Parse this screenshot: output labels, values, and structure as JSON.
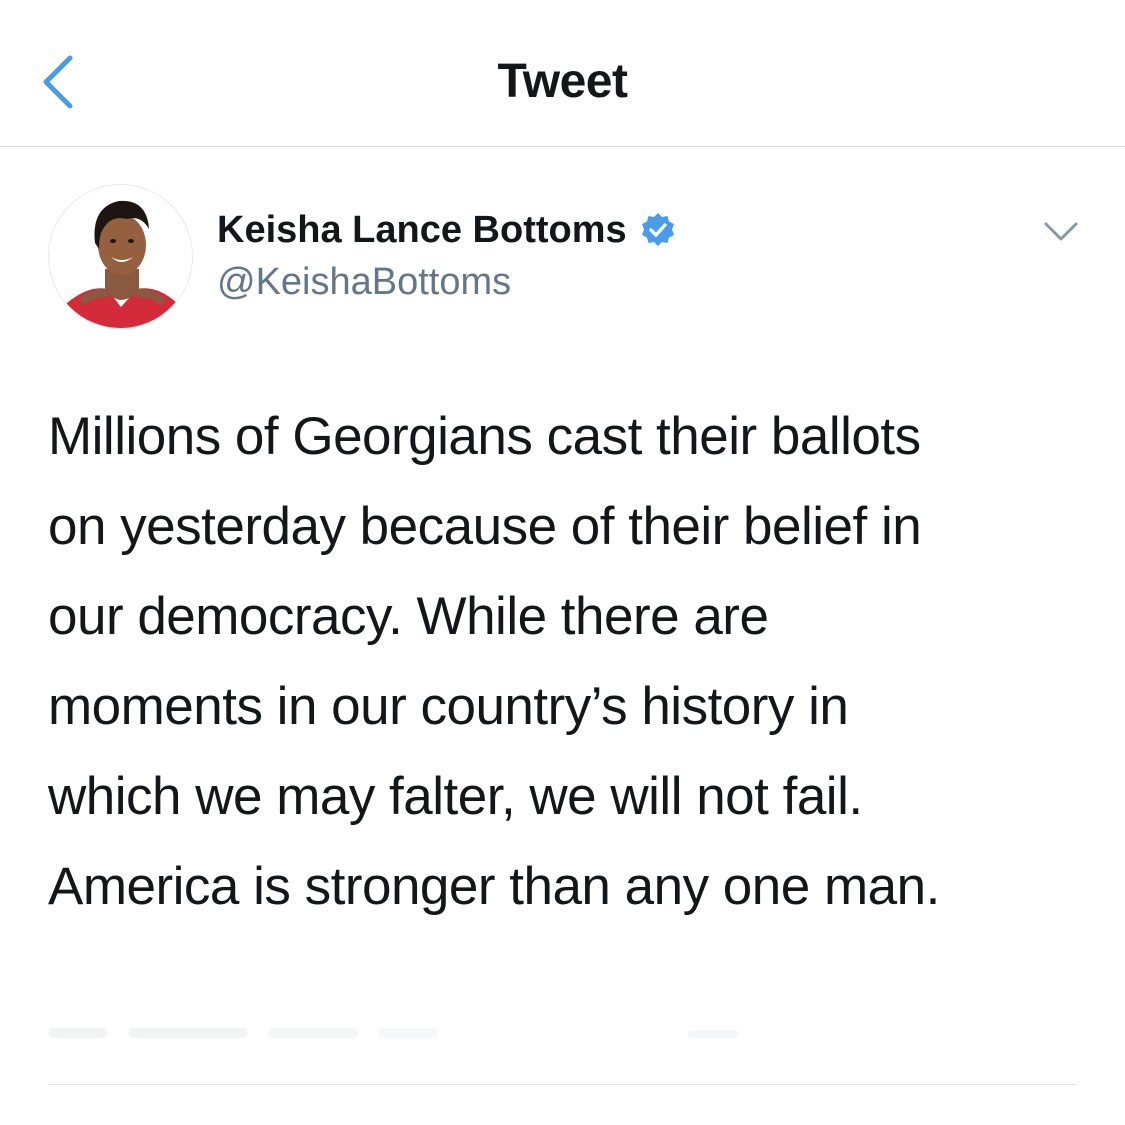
{
  "nav": {
    "title": "Tweet",
    "back_icon": "chevron-left-icon"
  },
  "author": {
    "display_name": "Keisha Lance Bottoms",
    "handle": "@KeishaBottoms",
    "verified_icon": "verified-badge-icon",
    "avatar_icon": "profile-photo"
  },
  "tweet": {
    "lines": [
      "Millions of Georgians cast their ballots",
      "on yesterday because of their belief in",
      "our democracy. While there are",
      "moments in our country’s history in",
      "which we may falter, we will not fail.",
      "America is stronger than any one man."
    ]
  },
  "more_icon": "chevron-down-icon",
  "colors": {
    "accent": "#4a9be8",
    "text": "#14171a",
    "secondary": "#657786",
    "divider": "#d4d6d9"
  }
}
